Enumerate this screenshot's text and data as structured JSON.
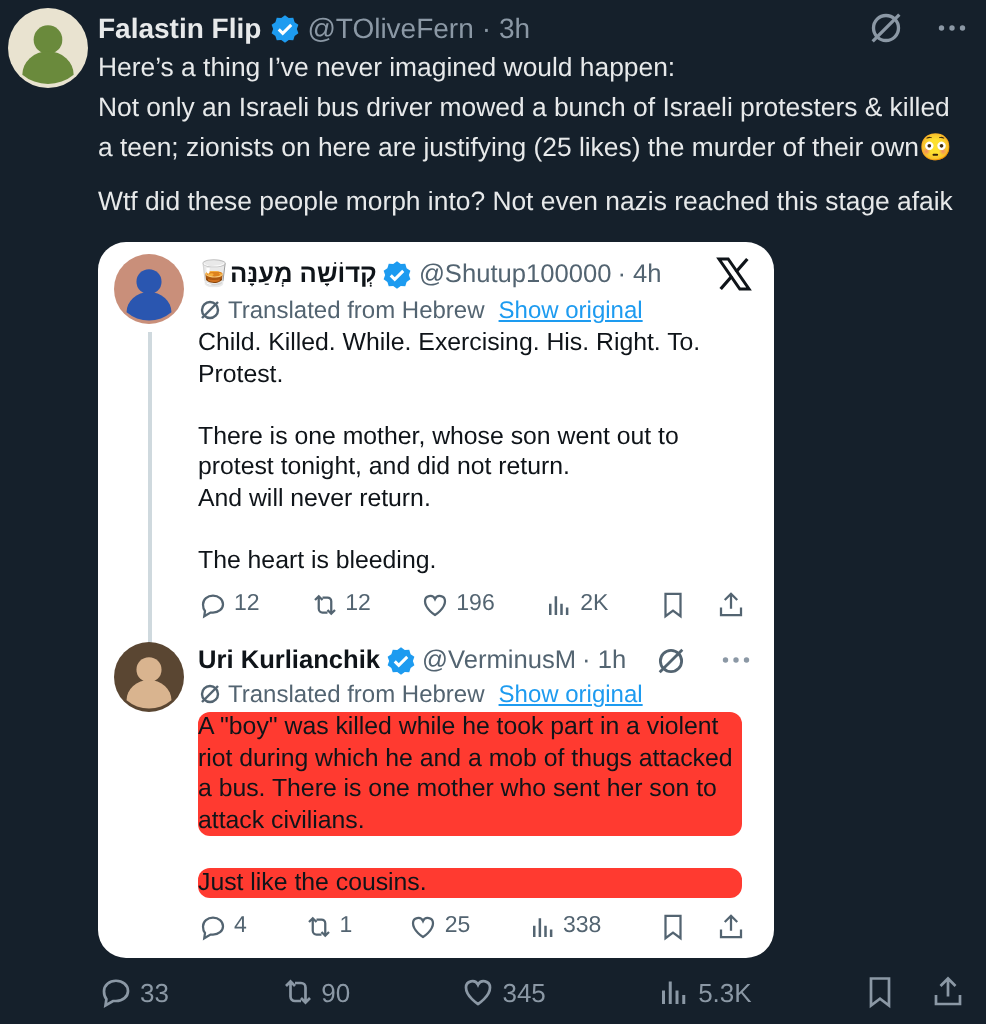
{
  "tweet": {
    "name": "Falastin Flip",
    "verified": true,
    "handle": "@TOliveFern",
    "time": "· 3h",
    "paragraphs": [
      "Here’s a thing I’ve never imagined would happen:\nNot only an Israeli bus driver mowed a bunch of Israeli protesters & killed a teen; zionists on here are justifying (25 likes) the murder of their own😳",
      "Wtf did these people morph into? Not even nazis reached this stage afaik"
    ],
    "quoted": [
      {
        "name": "קְדוֹשָׁה מְעַנָּה🥃",
        "verified": true,
        "handle": "@Shutup100000",
        "time": "· 4h",
        "x_logo": true,
        "menu": false,
        "translated": "Translated from Hebrew",
        "show_original": "Show original",
        "highlighted": false,
        "paragraphs": [
          "Child. Killed. While. Exercising. His. Right. To. Protest.",
          "There is one mother, whose son went out to protest tonight, and did not return.\nAnd will never return.",
          "The heart is bleeding."
        ],
        "stats": {
          "replies": "12",
          "reposts": "12",
          "likes": "196",
          "views": "2K"
        }
      },
      {
        "name": "Uri Kurlianchik",
        "verified": true,
        "handle": "@VerminusM",
        "time": "· 1h",
        "x_logo": false,
        "menu": true,
        "translated": "Translated from Hebrew",
        "show_original": "Show original",
        "highlighted": true,
        "paragraphs": [
          "A \"boy\" was killed while he took part in a violent riot during which he and a mob of thugs attacked a bus. There is one mother who sent her son to attack civilians.",
          "Just like the cousins."
        ],
        "stats": {
          "replies": "4",
          "reposts": "1",
          "likes": "25",
          "views": "338"
        }
      }
    ],
    "stats": {
      "replies": "33",
      "reposts": "90",
      "likes": "345",
      "views": "5.3K"
    }
  }
}
